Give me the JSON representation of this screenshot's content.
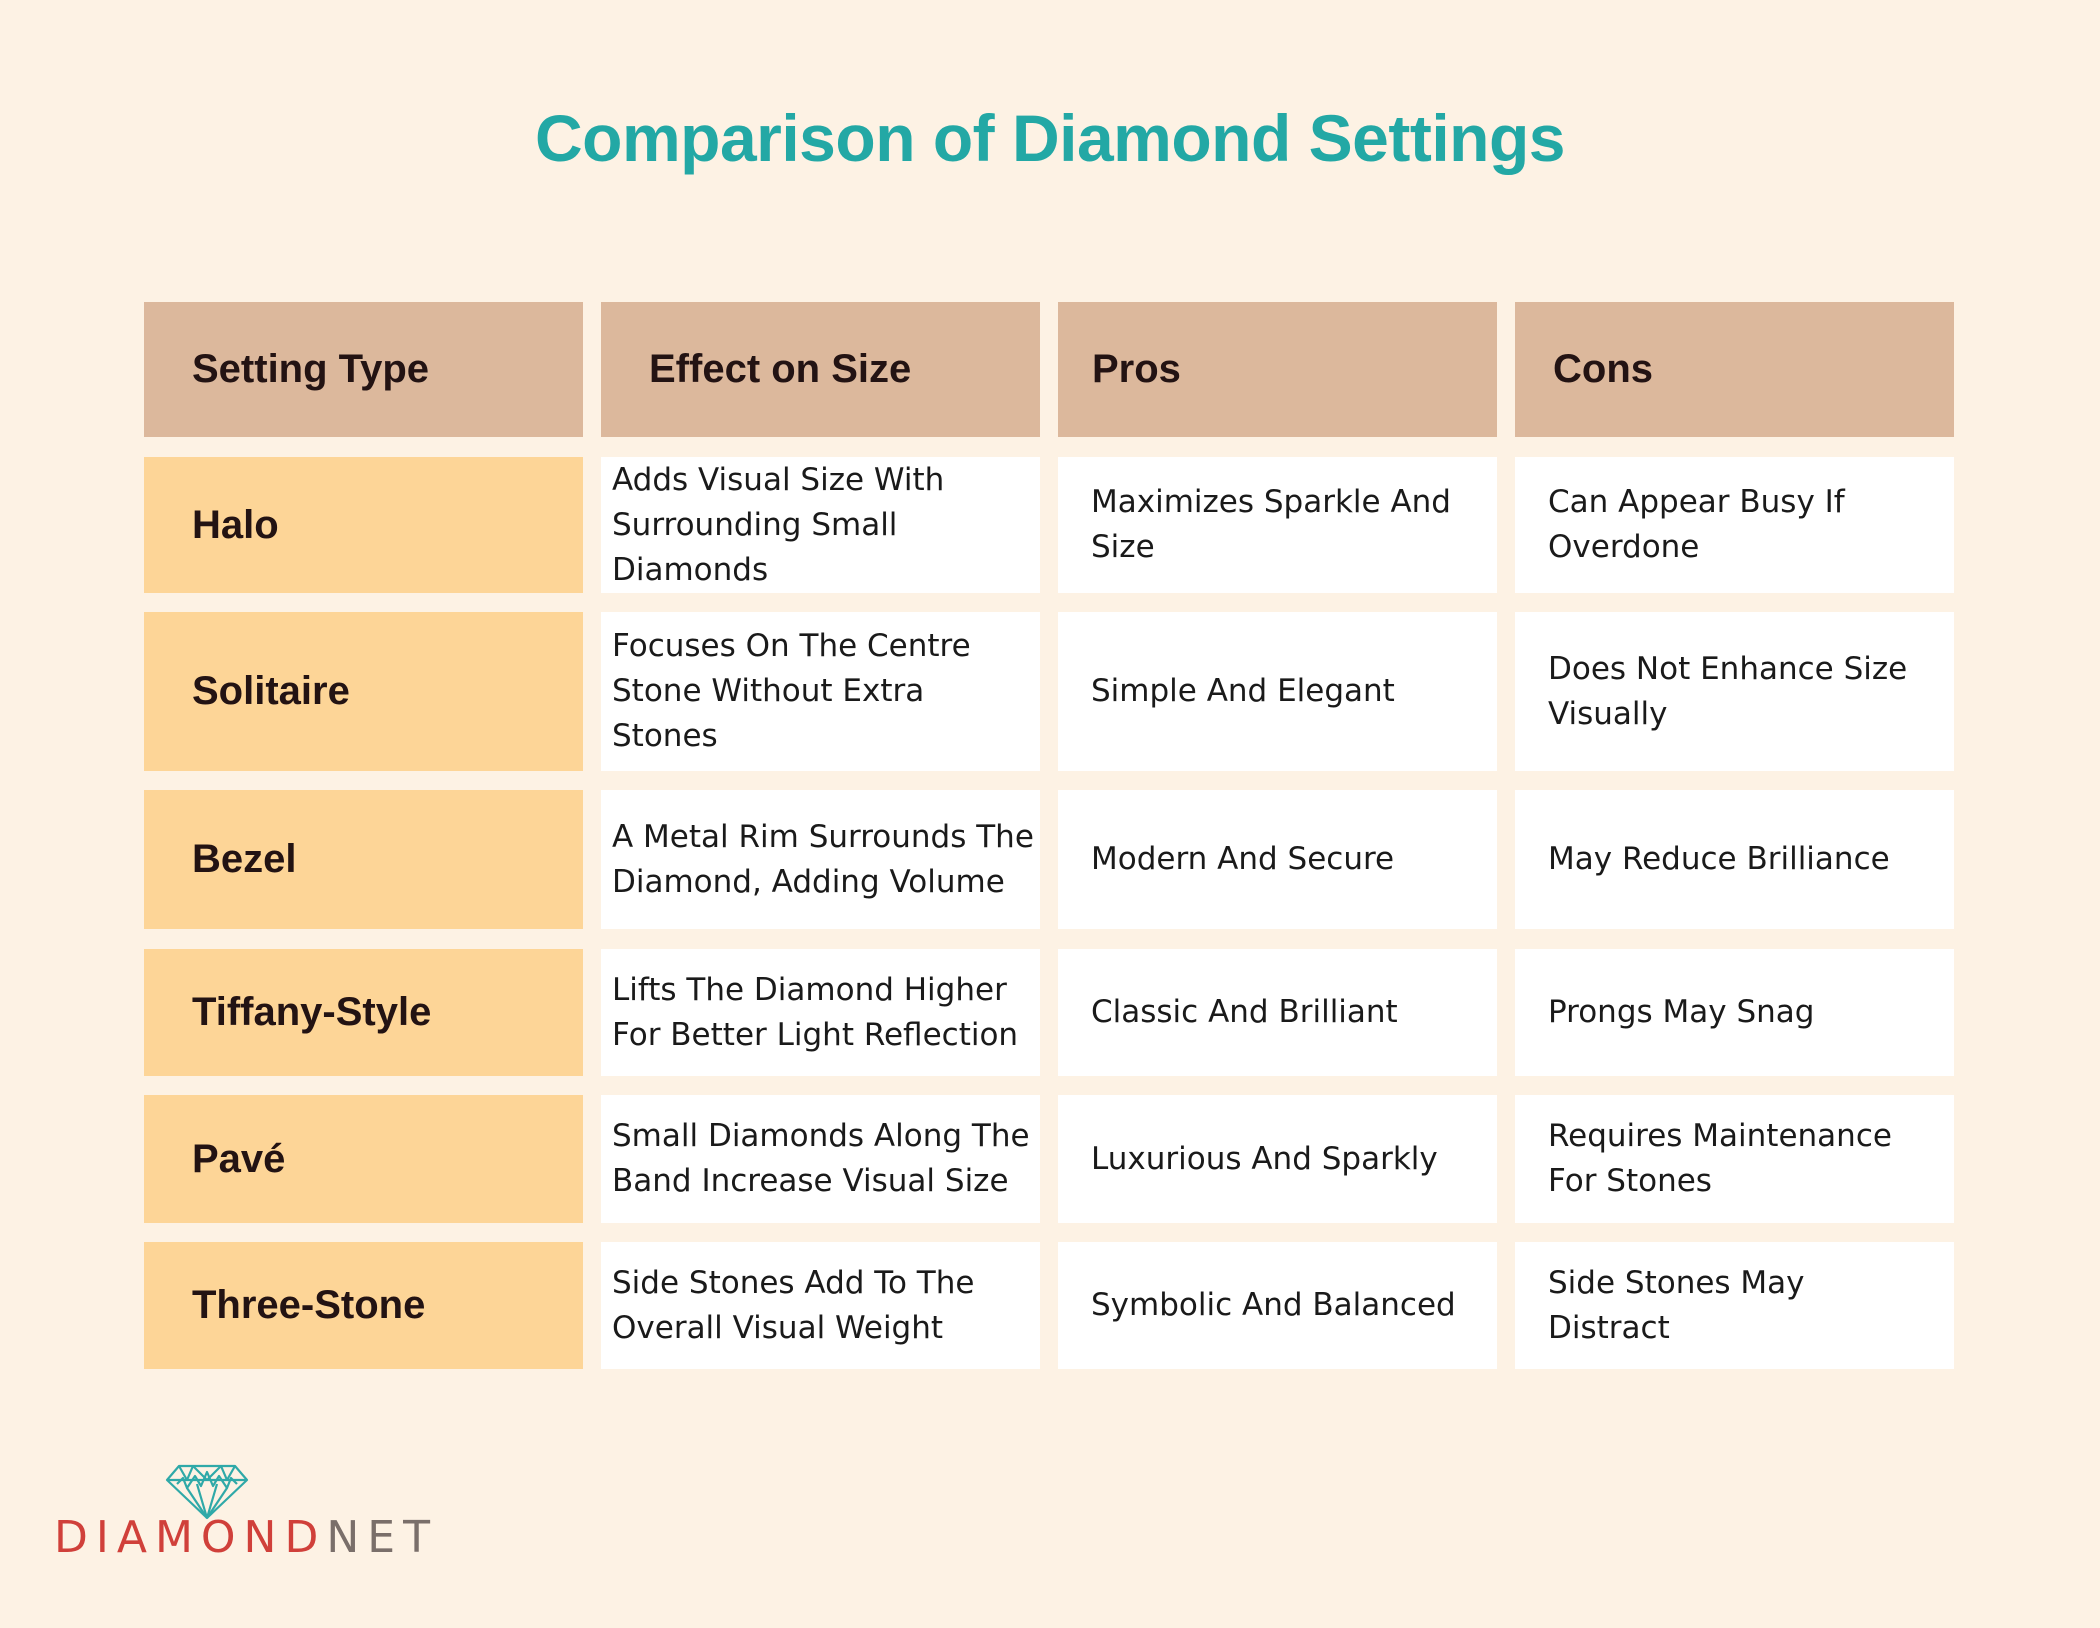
{
  "title": "Comparison of Diamond Settings",
  "colors": {
    "title": "#23a8a5",
    "header_bg": "#dcb89c",
    "row_head_bg": "#fdd597",
    "cell_bg": "#ffffff",
    "page_bg": "#fdf2e4",
    "logo_red": "#d0403a",
    "logo_gray": "#7a6f6a",
    "logo_icon": "#2fa9a8"
  },
  "table": {
    "headers": [
      "Setting Type",
      "Effect on Size",
      "Pros",
      "Cons"
    ],
    "rows": [
      {
        "type": "Halo",
        "effect": "Adds Visual Size With Surrounding Small Diamonds",
        "pros": "Maximizes Sparkle And Size",
        "cons": "Can Appear Busy If Overdone"
      },
      {
        "type": "Solitaire",
        "effect": "Focuses On The Centre Stone Without Extra Stones",
        "pros": "Simple And Elegant",
        "cons": "Does Not Enhance Size Visually"
      },
      {
        "type": "Bezel",
        "effect": "A Metal Rim Surrounds The Diamond, Adding Volume",
        "pros": "Modern And Secure",
        "cons": "May Reduce Brilliance"
      },
      {
        "type": "Tiffany-Style",
        "effect": "Lifts The Diamond Higher For Better Light Reflection",
        "pros": "Classic And Brilliant",
        "cons": "Prongs May Snag"
      },
      {
        "type": "Pavé",
        "effect": "Small Diamonds Along The Band Increase Visual Size",
        "pros": "Luxurious And Sparkly",
        "cons": "Requires Maintenance For Stones"
      },
      {
        "type": "Three-Stone",
        "effect": "Side Stones Add To The Overall Visual Weight",
        "pros": "Symbolic And Balanced",
        "cons": "Side Stones May Distract"
      }
    ]
  },
  "logo": {
    "icon": "diamond-icon",
    "word_primary": "DIAMOND",
    "word_secondary": "NET"
  }
}
